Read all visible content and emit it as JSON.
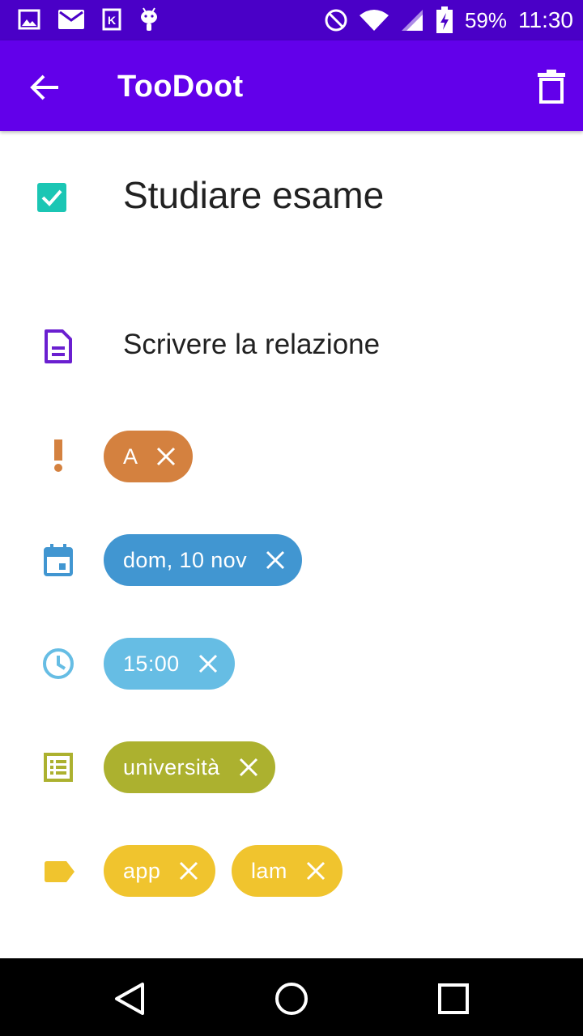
{
  "status_bar": {
    "battery": "59%",
    "time": "11:30",
    "left_icons": [
      "image-icon",
      "mail-icon",
      "k-app-icon",
      "android-icon"
    ],
    "right_icons": [
      "do-not-disturb-icon",
      "wifi-icon",
      "signal-icon",
      "battery-charging-icon"
    ]
  },
  "app_bar": {
    "title": "TooDoot",
    "color": "#6200ea"
  },
  "task": {
    "title": "Studiare esame",
    "completed": true,
    "note": "Scrivere la relazione"
  },
  "priority": {
    "label": "A",
    "color": "#d4813f"
  },
  "date": {
    "label": "dom, 10 nov",
    "color": "#4196d1"
  },
  "time": {
    "label": "15:00",
    "color": "#66bde4"
  },
  "list": {
    "label": "università",
    "color": "#acb12f"
  },
  "tags": [
    {
      "label": "app",
      "color": "#f0c42e"
    },
    {
      "label": "lam",
      "color": "#f0c42e"
    }
  ]
}
